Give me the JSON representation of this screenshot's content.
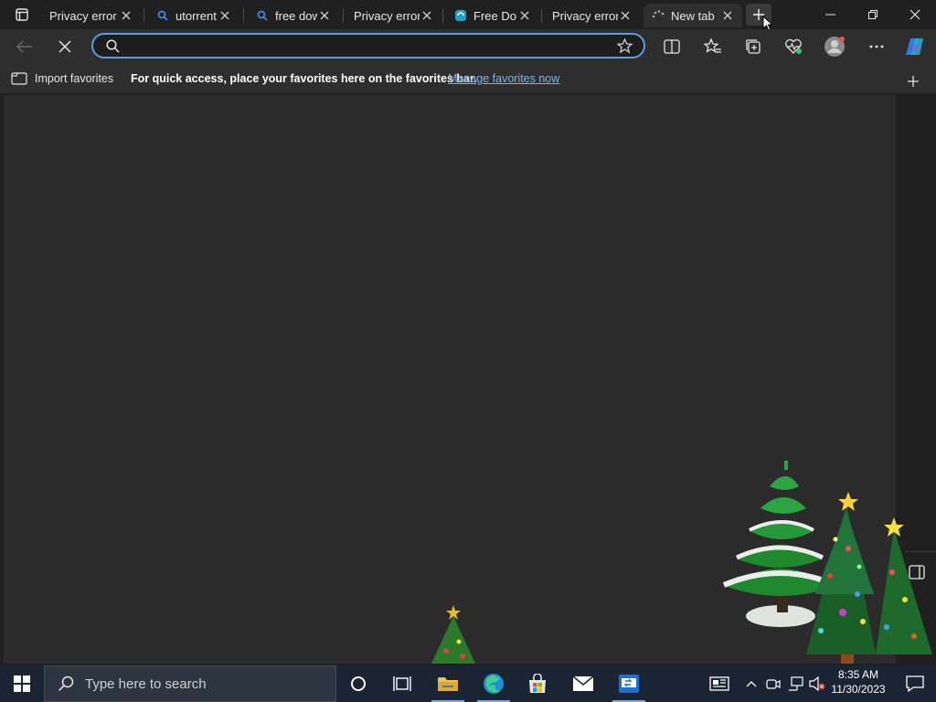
{
  "tabs": [
    {
      "title": "Privacy error",
      "favicon": "privacy-error-icon"
    },
    {
      "title": "utorrent",
      "favicon": "search-icon"
    },
    {
      "title": "free dow",
      "favicon": "search-icon"
    },
    {
      "title": "Privacy error",
      "favicon": "privacy-error-icon"
    },
    {
      "title": "Free Do",
      "favicon": "edge-page-icon"
    },
    {
      "title": "Privacy error",
      "favicon": "privacy-error-icon"
    },
    {
      "title": "New tab",
      "favicon": "loading-spinner-icon",
      "active": true
    }
  ],
  "address": {
    "value": "",
    "placeholder": ""
  },
  "favorites_bar": {
    "import_label": "Import favorites",
    "message": "For quick access, place your favorites here on the favorites bar.",
    "manage_link": "Manage favorites now"
  },
  "taskbar": {
    "search_placeholder": "Type here to search",
    "time": "8:35 AM",
    "date": "11/30/2023"
  },
  "colors": {
    "accent": "#5a9ee0",
    "link": "#7db4f5",
    "taskbar": "#1a2433"
  }
}
